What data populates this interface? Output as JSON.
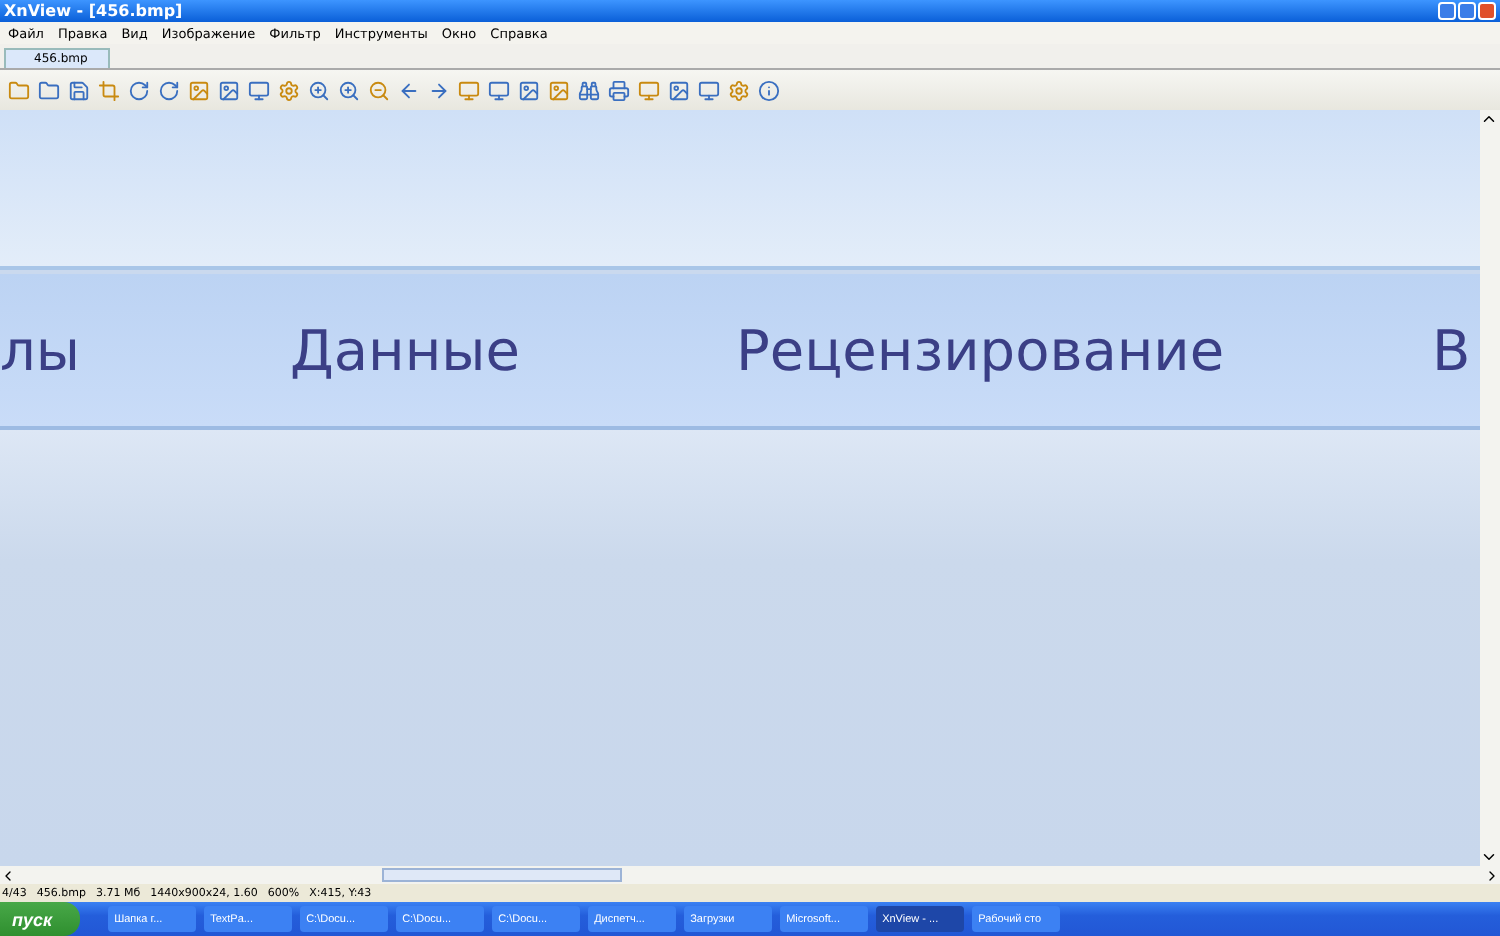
{
  "window": {
    "title": "XnView - [456.bmp]"
  },
  "menu": [
    "Файл",
    "Правка",
    "Вид",
    "Изображение",
    "Фильтр",
    "Инструменты",
    "Окно",
    "Справка"
  ],
  "tabs": [
    {
      "label": "456.bmp",
      "selected": true
    }
  ],
  "image": {
    "ribbon_tabs": [
      "лы",
      "Данные",
      "Рецензирование",
      "В"
    ]
  },
  "status_bar": [
    "4/43",
    "456.bmp",
    "3.71 Мб",
    "1440x900x24, 1.60",
    "600%",
    "X:415, Y:43"
  ],
  "taskbar": {
    "start": "пуск",
    "items": [
      {
        "label": "Шапка г...",
        "selected": false
      },
      {
        "label": "TextPa...",
        "selected": false
      },
      {
        "label": "C:\\Docu...",
        "selected": false
      },
      {
        "label": "C:\\Docu...",
        "selected": false
      },
      {
        "label": "C:\\Docu...",
        "selected": false
      },
      {
        "label": "Диспетч...",
        "selected": false
      },
      {
        "label": "Загрузки",
        "selected": false
      },
      {
        "label": "Microsoft...",
        "selected": false
      },
      {
        "label": "XnView - ...",
        "selected": true
      },
      {
        "label": "Рабочий сто",
        "selected": false
      }
    ]
  }
}
